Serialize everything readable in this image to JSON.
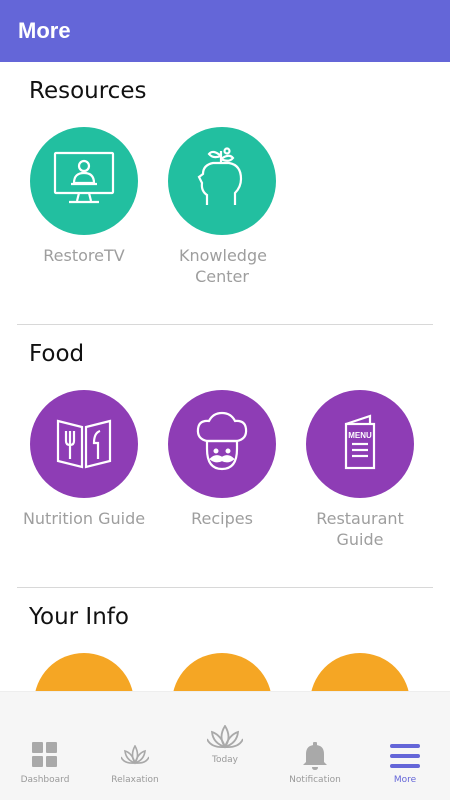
{
  "header": {
    "title": "More"
  },
  "colors": {
    "accent": "#6466d8",
    "teal": "#22bfa0",
    "purple": "#8e3db5",
    "orange": "#f5a624"
  },
  "sections": {
    "resources": {
      "title": "Resources",
      "items": [
        {
          "label": "RestoreTV",
          "icon": "monitor-person-icon"
        },
        {
          "label": "Knowledge Center",
          "icon": "head-sprout-icon"
        }
      ]
    },
    "food": {
      "title": "Food",
      "items": [
        {
          "label": "Nutrition Guide",
          "icon": "book-fork-knife-icon"
        },
        {
          "label": "Recipes",
          "icon": "chef-hat-icon"
        },
        {
          "label": "Restaurant Guide",
          "icon": "menu-card-icon"
        }
      ]
    },
    "your_info": {
      "title": "Your Info"
    }
  },
  "bottom_nav": {
    "items": [
      {
        "label": "Dashboard",
        "icon": "grid-icon"
      },
      {
        "label": "Relaxation",
        "icon": "lotus-icon"
      },
      {
        "label": "Today",
        "icon": "lotus-large-icon"
      },
      {
        "label": "Notification",
        "icon": "bell-icon"
      },
      {
        "label": "More",
        "icon": "hamburger-icon",
        "active": true
      }
    ]
  }
}
